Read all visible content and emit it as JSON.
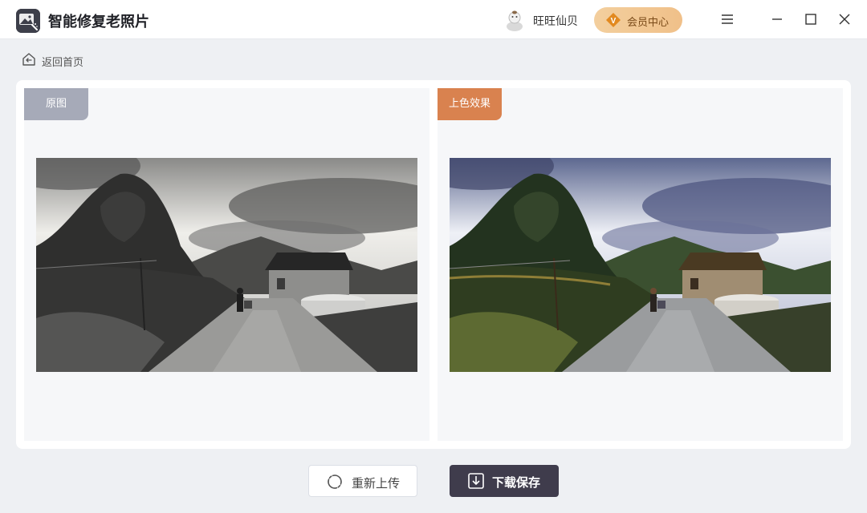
{
  "app": {
    "title": "智能修复老照片",
    "logo_icon": "photo-magic-icon"
  },
  "user": {
    "name": "旺旺仙贝",
    "avatar_icon": "avatar-icon"
  },
  "vip": {
    "label": "会员中心",
    "badge_icon": "vip-badge-icon",
    "color": "#f0c089"
  },
  "window_controls": [
    "menu-icon",
    "minimize-icon",
    "maximize-icon",
    "close-icon"
  ],
  "nav": {
    "back_label": "返回首页",
    "back_icon": "home-back-icon"
  },
  "panels": {
    "original": {
      "tag": "原图",
      "tag_color": "#a6aab8",
      "mode": "grayscale"
    },
    "colorized": {
      "tag": "上色效果",
      "tag_color": "#d9824f",
      "mode": "color"
    }
  },
  "actions": {
    "reupload_label": "重新上传",
    "reupload_icon": "refresh-icon",
    "save_label": "下载保存",
    "save_icon": "download-icon",
    "save_color": "#3f3c4c"
  }
}
